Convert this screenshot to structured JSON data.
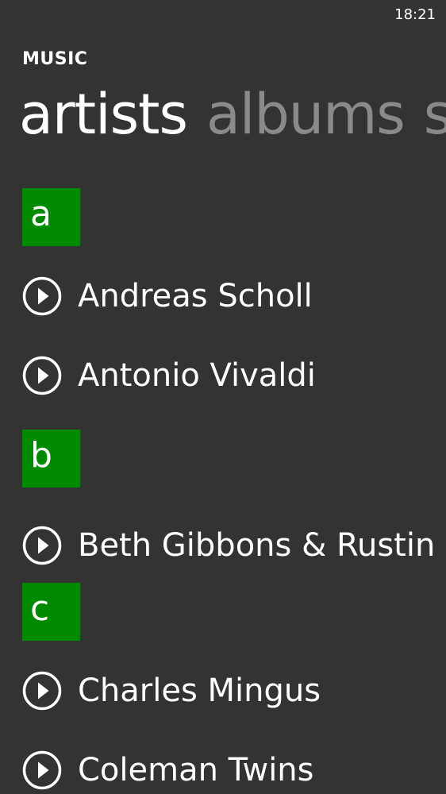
{
  "status_bar": {
    "time": "18:21"
  },
  "app": {
    "title": "MUSIC"
  },
  "pivot": {
    "tabs": [
      {
        "label": "artists",
        "active": true
      },
      {
        "label": "albums",
        "active": false
      },
      {
        "label": "s",
        "active": false
      }
    ]
  },
  "groups": [
    {
      "letter": "a",
      "artists": [
        {
          "name": "Andreas Scholl",
          "icon": "play-circle-icon"
        },
        {
          "name": "Antonio Vivaldi",
          "icon": "play-circle-icon"
        }
      ]
    },
    {
      "letter": "b",
      "artists": [
        {
          "name": "Beth Gibbons & Rustin Man",
          "icon": "play-circle-icon"
        }
      ]
    },
    {
      "letter": "c",
      "artists": [
        {
          "name": "Charles Mingus",
          "icon": "play-circle-icon"
        },
        {
          "name": "Coleman Twins",
          "icon": "play-circle-icon"
        }
      ]
    }
  ],
  "colors": {
    "background": "#333333",
    "accent": "#008a00",
    "text": "#ffffff",
    "inactive_tab": "#8a8a8a"
  }
}
